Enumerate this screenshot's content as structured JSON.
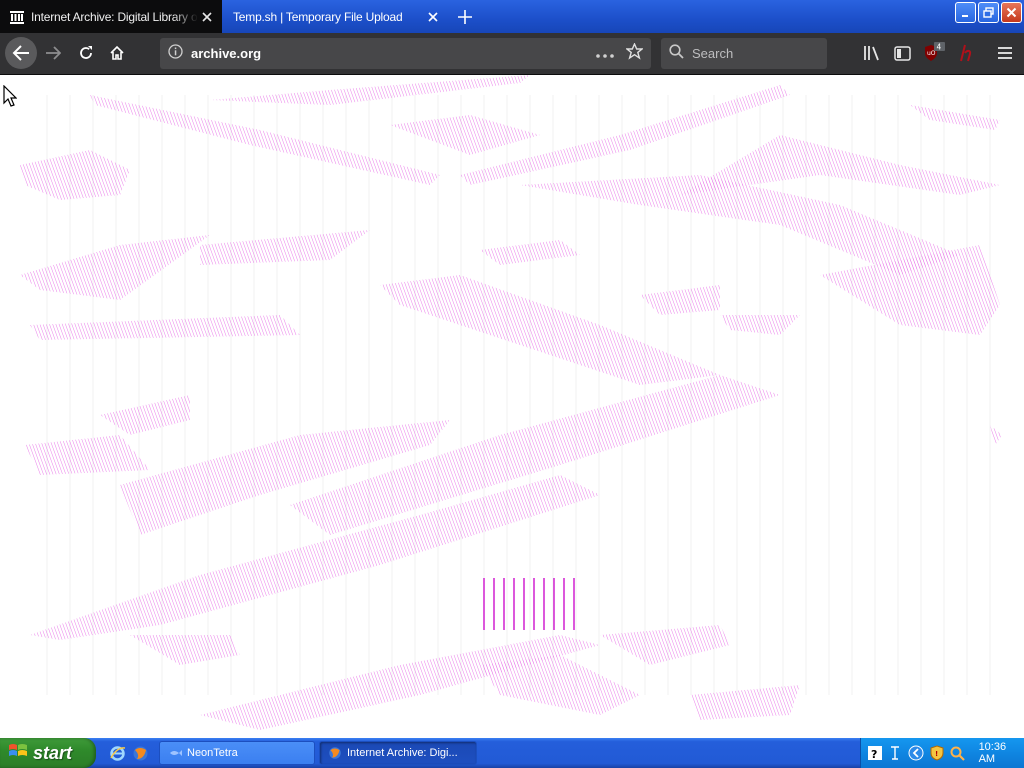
{
  "browser": {
    "tabs": [
      {
        "title": "Internet Archive: Digital Library of Free & Borrowable Books, Movies, Music & Wayback Machine",
        "active": true,
        "favicon": "archive-building-icon"
      },
      {
        "title": "Temp.sh | Temporary File Upload",
        "active": false
      }
    ],
    "newtab_icon": "plus-icon",
    "url": "archive.org",
    "search_placeholder": "Search",
    "toolbar_icons": [
      "back-icon",
      "forward-icon",
      "reload-icon",
      "home-icon",
      "info-icon",
      "more-icon",
      "bookmark-star-icon",
      "library-icon",
      "sidebar-icon",
      "ublock-icon",
      "extension-h-icon",
      "menu-icon"
    ],
    "ublock_badge": "4"
  },
  "taskbar": {
    "start_label": "start",
    "tasks": [
      {
        "label": "NeonTetra"
      },
      {
        "label": "Internet Archive: Digi..."
      }
    ],
    "clock": "10:36 AM"
  },
  "colors": {
    "tab_strip": "#1c4fc9",
    "toolbar": "#323234",
    "pattern": "#e040e0",
    "taskbar": "#245edb",
    "start": "#2f8a2b"
  }
}
